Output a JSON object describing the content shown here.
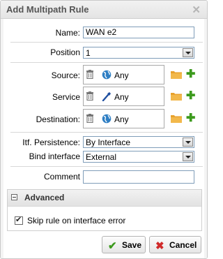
{
  "window": {
    "title": "Add Multipath Rule",
    "close_icon": "close-icon"
  },
  "form": {
    "name_label": "Name:",
    "name_value": "WAN e2",
    "position_label": "Position",
    "position_value": "1",
    "source_label": "Source:",
    "source_value": "Any",
    "service_label": "Service",
    "service_value": "Any",
    "destination_label": "Destination:",
    "destination_value": "Any",
    "persistence_label": "Itf. Persistence:",
    "persistence_value": "By Interface",
    "bind_label": "Bind interface",
    "bind_value": "External",
    "comment_label": "Comment",
    "comment_value": ""
  },
  "advanced": {
    "title": "Advanced",
    "skip_label": "Skip rule on interface error",
    "skip_checked": true
  },
  "buttons": {
    "save": "Save",
    "cancel": "Cancel"
  },
  "colors": {
    "accent_green": "#3c9a1d",
    "cancel_red": "#d02a2a",
    "folder_orange": "#e8a12c"
  }
}
